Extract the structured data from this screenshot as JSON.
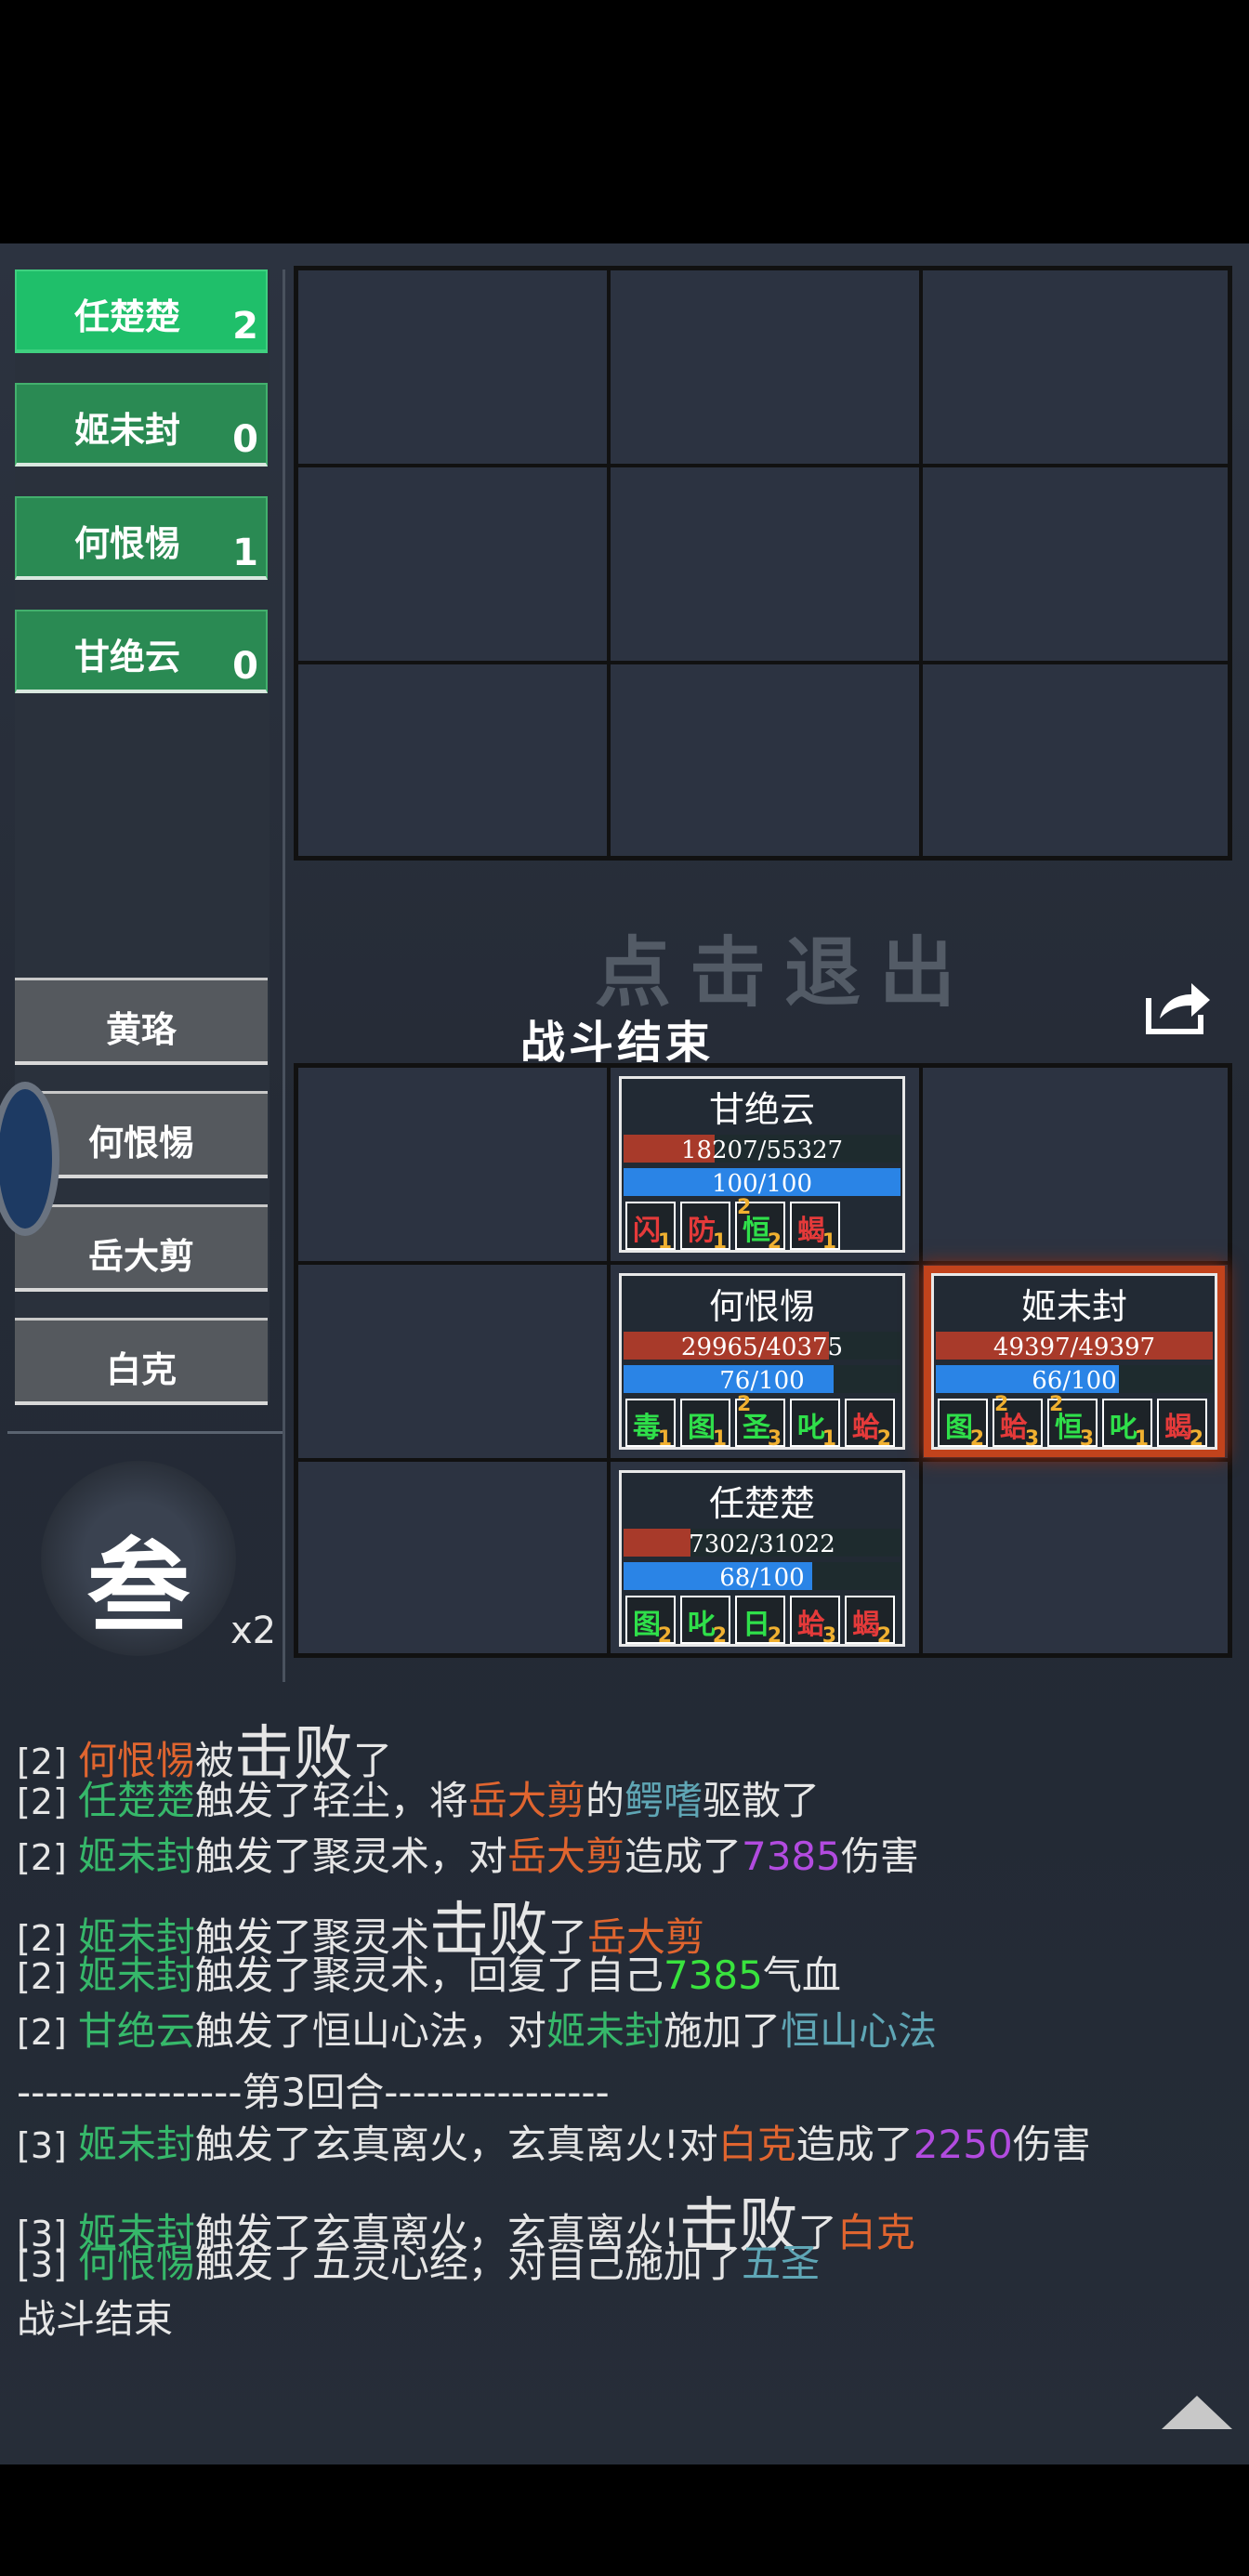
{
  "team": [
    {
      "name": "任楚楚",
      "count": "2",
      "active": true
    },
    {
      "name": "姬未封",
      "count": "0",
      "active": false
    },
    {
      "name": "何恨惕",
      "count": "1",
      "active": false
    },
    {
      "name": "甘绝云",
      "count": "0",
      "active": false
    }
  ],
  "enemies": [
    "黄珞",
    "何恨惕",
    "岳大剪",
    "白克"
  ],
  "speed": {
    "char": "叁",
    "multiplier": "x2"
  },
  "exit_text": "点击退出",
  "battle_end": "战斗结束",
  "units": [
    {
      "name": "甘绝云",
      "hp": "18207/55327",
      "hp_ratio": 0.33,
      "mp": "100/100",
      "mp_ratio": 1.0,
      "highlight": false,
      "buffs": [
        {
          "g": "闪",
          "c": "#e53a3a",
          "sub": "1",
          "sup": ""
        },
        {
          "g": "防",
          "c": "#e53a3a",
          "sub": "1",
          "sup": ""
        },
        {
          "g": "恒",
          "c": "#2fe04a",
          "sub": "2",
          "sup": "2"
        },
        {
          "g": "蝎",
          "c": "#e53a3a",
          "sub": "1",
          "sup": ""
        }
      ]
    },
    {
      "name": "何恨惕",
      "hp": "29965/40375",
      "hp_ratio": 0.74,
      "mp": "76/100",
      "mp_ratio": 0.76,
      "highlight": false,
      "buffs": [
        {
          "g": "毒",
          "c": "#2fe04a",
          "sub": "1",
          "sup": ""
        },
        {
          "g": "图",
          "c": "#2fe04a",
          "sub": "1",
          "sup": ""
        },
        {
          "g": "圣",
          "c": "#2fe04a",
          "sub": "3",
          "sup": "2"
        },
        {
          "g": "叱",
          "c": "#2fe04a",
          "sub": "1",
          "sup": ""
        },
        {
          "g": "蛤",
          "c": "#e53a3a",
          "sub": "2",
          "sup": ""
        }
      ]
    },
    {
      "name": "姬未封",
      "hp": "49397/49397",
      "hp_ratio": 1.0,
      "mp": "66/100",
      "mp_ratio": 0.66,
      "highlight": true,
      "buffs": [
        {
          "g": "图",
          "c": "#2fe04a",
          "sub": "2",
          "sup": ""
        },
        {
          "g": "蛤",
          "c": "#e53a3a",
          "sub": "3",
          "sup": "2"
        },
        {
          "g": "恒",
          "c": "#2fe04a",
          "sub": "3",
          "sup": "2"
        },
        {
          "g": "叱",
          "c": "#2fe04a",
          "sub": "1",
          "sup": ""
        },
        {
          "g": "蝎",
          "c": "#e53a3a",
          "sub": "2",
          "sup": ""
        }
      ]
    },
    {
      "name": "任楚楚",
      "hp": "7302/31022",
      "hp_ratio": 0.24,
      "mp": "68/100",
      "mp_ratio": 0.68,
      "highlight": false,
      "buffs": [
        {
          "g": "图",
          "c": "#2fe04a",
          "sub": "2",
          "sup": ""
        },
        {
          "g": "叱",
          "c": "#2fe04a",
          "sub": "2",
          "sup": ""
        },
        {
          "g": "日",
          "c": "#2fe04a",
          "sub": "2",
          "sup": ""
        },
        {
          "g": "蛤",
          "c": "#e53a3a",
          "sub": "3",
          "sup": ""
        },
        {
          "g": "蝎",
          "c": "#e53a3a",
          "sub": "2",
          "sup": ""
        }
      ]
    }
  ],
  "log": [
    [
      {
        "t": "[2] ",
        "c": "tag"
      },
      {
        "t": "何恨惕",
        "c": "c-o"
      },
      {
        "t": "被"
      },
      {
        "t": "击败",
        "c": "big"
      },
      {
        "t": "了"
      }
    ],
    [
      {
        "t": "[2] ",
        "c": "tag"
      },
      {
        "t": "任楚楚",
        "c": "c-g"
      },
      {
        "t": "触发了轻尘，将"
      },
      {
        "t": "岳大剪",
        "c": "c-o"
      },
      {
        "t": "的"
      },
      {
        "t": "鳄嗜",
        "c": "c-t"
      },
      {
        "t": "驱散了"
      }
    ],
    [
      {
        "t": "[2] ",
        "c": "tag"
      },
      {
        "t": "姬未封",
        "c": "c-g"
      },
      {
        "t": "触发了聚灵术，对"
      },
      {
        "t": "岳大剪",
        "c": "c-o"
      },
      {
        "t": "造成了"
      },
      {
        "t": "7385",
        "c": "c-p"
      },
      {
        "t": "伤害"
      }
    ],
    [
      {
        "t": "[2] ",
        "c": "tag"
      },
      {
        "t": "姬未封",
        "c": "c-g"
      },
      {
        "t": "触发了聚灵术"
      },
      {
        "t": "击败",
        "c": "big"
      },
      {
        "t": "了"
      },
      {
        "t": "岳大剪",
        "c": "c-o"
      }
    ],
    [
      {
        "t": "[2] ",
        "c": "tag"
      },
      {
        "t": "姬未封",
        "c": "c-g"
      },
      {
        "t": "触发了聚灵术，回复了自己"
      },
      {
        "t": "7385",
        "c": "c-lg"
      },
      {
        "t": "气血"
      }
    ],
    [
      {
        "t": "[2] ",
        "c": "tag"
      },
      {
        "t": "甘绝云",
        "c": "c-g"
      },
      {
        "t": "触发了恒山心法，对"
      },
      {
        "t": "姬未封",
        "c": "c-g"
      },
      {
        "t": "施加了"
      },
      {
        "t": "恒山心法",
        "c": "c-t"
      }
    ],
    [
      {
        "t": "----------------第3回合----------------"
      }
    ],
    [
      {
        "t": "[3] ",
        "c": "tag"
      },
      {
        "t": "姬未封",
        "c": "c-g"
      },
      {
        "t": "触发了玄真离火，玄真离火!对"
      },
      {
        "t": "白克",
        "c": "c-o"
      },
      {
        "t": "造成了"
      },
      {
        "t": "2250",
        "c": "c-p"
      },
      {
        "t": "伤害"
      }
    ],
    [
      {
        "t": "[3] ",
        "c": "tag"
      },
      {
        "t": "姬未封",
        "c": "c-g"
      },
      {
        "t": "触发了玄真离火，玄真离火!"
      },
      {
        "t": "击败",
        "c": "big"
      },
      {
        "t": "了"
      },
      {
        "t": "白克",
        "c": "c-o"
      }
    ],
    [
      {
        "t": "[3] ",
        "c": "tag"
      },
      {
        "t": "何恨惕",
        "c": "c-g"
      },
      {
        "t": "触发了五灵心经，对自己施加了"
      },
      {
        "t": "五圣",
        "c": "c-t"
      }
    ],
    [
      {
        "t": "战斗结束"
      }
    ]
  ]
}
